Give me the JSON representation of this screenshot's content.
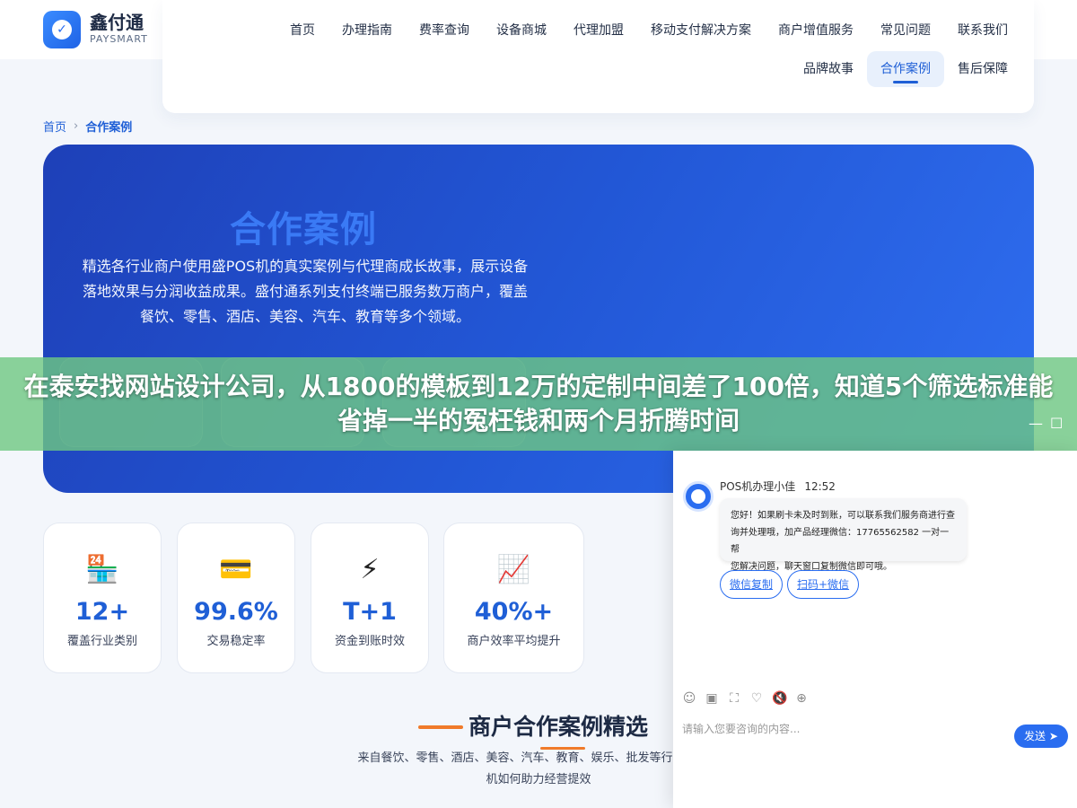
{
  "brand": {
    "name_cn": "鑫付通",
    "name_en": "PAYSMART"
  },
  "nav": {
    "row1": [
      "首页",
      "办理指南",
      "费率查询",
      "设备商城",
      "代理加盟",
      "移动支付解决方案",
      "商户增值服务",
      "常见问题",
      "联系我们"
    ],
    "row2": [
      "品牌故事",
      "合作案例",
      "售后保障"
    ],
    "active": "合作案例"
  },
  "breadcrumb": {
    "home": "首页",
    "sep": "›",
    "current": "合作案例"
  },
  "hero": {
    "title": "合作案例",
    "description_lines": [
      "精选各行业商户使用盛POS机的真实案例与代理商成长故事，展示设备",
      "落地效果与分润收益成果。盛付通系列支付终端已服务数万商户，覆盖",
      "餐饮、零售、酒店、美容、汽车、教育等多个领域。"
    ]
  },
  "overlay_title": "在泰安找网站设计公司，从1800的模板到12万的定制中间差了100倍，知道5个筛选标准能省掉一半的冤枉钱和两个月折腾时间",
  "stats": [
    {
      "icon": "🏪",
      "icon_name": "store-icon",
      "value": "12+",
      "label": "覆盖行业类别"
    },
    {
      "icon": "💳",
      "icon_name": "card-icon",
      "value": "99.6%",
      "label": "交易稳定率"
    },
    {
      "icon": "⚡",
      "icon_name": "lightning-icon",
      "value": "T+1",
      "label": "资金到账时效"
    },
    {
      "icon": "📈",
      "icon_name": "chart-up-icon",
      "value": "40%+",
      "label": "商户效率平均提升"
    }
  ],
  "section": {
    "title": "商户合作案例精选",
    "description_lines": [
      "来自餐饮、零售、酒店、美容、汽车、教育、娱乐、批发等行业的真实",
      "机如何助力经营提效"
    ]
  },
  "window_controls": {
    "minimize": "—",
    "maximize": "☐"
  },
  "chat": {
    "agent_name": "POS机办理小佳",
    "time": "12:52",
    "message_lines": [
      "您好！如果刷卡未及时到账，可以联系我们服务商进行查",
      "询并处理哦，加产品经理微信：17765562582 一对一帮",
      "您解决问题，聊天窗口复制微信即可哦。"
    ],
    "chips": [
      "微信复制",
      "扫码+微信"
    ],
    "tool_icons": [
      {
        "glyph": "☺",
        "name": "emoji-icon"
      },
      {
        "glyph": "▣",
        "name": "image-icon"
      },
      {
        "glyph": "⛶",
        "name": "screenshot-icon"
      },
      {
        "glyph": "♡",
        "name": "evaluate-icon"
      },
      {
        "glyph": "🔇",
        "name": "mute-icon"
      },
      {
        "glyph": "⊕",
        "name": "more-icon"
      }
    ],
    "input_placeholder": "请输入您要咨询的内容...",
    "send_label": "发送",
    "send_arrow": "➤"
  }
}
